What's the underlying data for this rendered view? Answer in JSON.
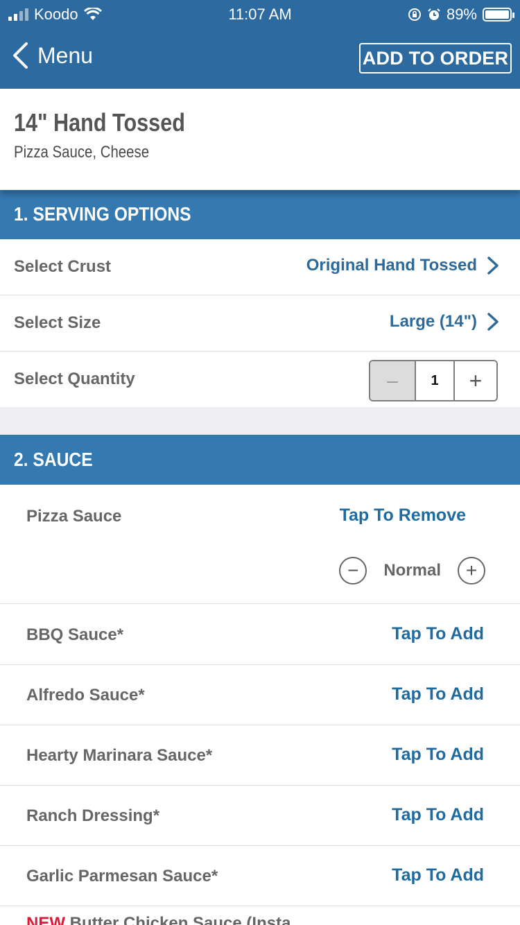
{
  "status_bar": {
    "carrier": "Koodo",
    "time": "11:07 AM",
    "battery_percent": "89%"
  },
  "nav": {
    "back_label": "Menu",
    "add_to_order_label": "ADD TO ORDER"
  },
  "product": {
    "title": "14\" Hand Tossed",
    "subtitle": "Pizza Sauce, Cheese"
  },
  "section1": {
    "title": "1. SERVING OPTIONS",
    "rows": [
      {
        "label": "Select Crust",
        "value": "Original Hand Tossed"
      },
      {
        "label": "Select Size",
        "value": "Large (14\")"
      }
    ],
    "quantity": {
      "label": "Select Quantity",
      "minus": "–",
      "value": "1",
      "plus": "+"
    }
  },
  "section2": {
    "title": "2. SAUCE",
    "selected": {
      "label": "Pizza Sauce",
      "action": "Tap To Remove",
      "amount": "Normal",
      "decrease": "−",
      "increase": "+"
    },
    "options": [
      {
        "label": "BBQ Sauce*",
        "action": "Tap To Add"
      },
      {
        "label": "Alfredo Sauce*",
        "action": "Tap To Add"
      },
      {
        "label": "Hearty Marinara Sauce*",
        "action": "Tap To Add"
      },
      {
        "label": "Ranch Dressing*",
        "action": "Tap To Add"
      },
      {
        "label": "Garlic Parmesan Sauce*",
        "action": "Tap To Add"
      }
    ],
    "partial_item": {
      "badge": "NEW",
      "label": "Butter Chicken Sauce (Insta"
    }
  },
  "colors": {
    "header_blue": "#2c6aa0",
    "section_blue": "#3579b1",
    "link_blue": "#1f6b9f",
    "new_red": "#e31837"
  }
}
